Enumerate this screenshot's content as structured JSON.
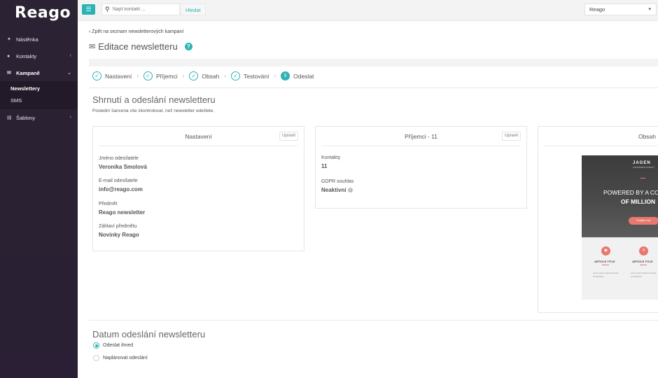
{
  "app": {
    "logo": "Reago"
  },
  "sidebar": {
    "items": [
      {
        "label": "Nástěnka",
        "icon": "pin-icon"
      },
      {
        "label": "Kontakty",
        "icon": "users-icon"
      },
      {
        "label": "Kampaně",
        "icon": "envelope-icon"
      },
      {
        "label": "Šablony",
        "icon": "book-icon"
      }
    ],
    "campaign_sub": [
      {
        "label": "Newslettery"
      },
      {
        "label": "SMS"
      }
    ]
  },
  "topbar": {
    "search_placeholder": "Najít kontakt ...",
    "search_button": "Hledat",
    "account": "Reago"
  },
  "page": {
    "back_link": "Zpět na seznam newsletterových kampaní",
    "title": "Editace newsletteru",
    "steps": [
      "Nastavení",
      "Příjemci",
      "Obsah",
      "Testování",
      "Odeslat"
    ],
    "current_step_number": "5",
    "summary_title": "Shrnutí a odeslání newsletteru",
    "summary_subtitle": "Poslední šancena vše zkontrolovat, než newsletter odešlete."
  },
  "cards": {
    "settings": {
      "title": "Nastavení",
      "edit": "Upravit",
      "fields": [
        {
          "label": "Jméno odesílatele",
          "value": "Veronika Smolová"
        },
        {
          "label": "E-mail odesílatele",
          "value": "info@reago.com"
        },
        {
          "label": "Předmět",
          "value": "Reago newsletter"
        },
        {
          "label": "Záhlaví předmětu",
          "value": "Novinky Reago"
        }
      ]
    },
    "recipients": {
      "title": "Příjemci - 11",
      "edit": "Upravit",
      "fields": [
        {
          "label": "Kontakty",
          "value": "11"
        },
        {
          "label": "GDPR souhlas",
          "value": "Neaktivní"
        }
      ]
    },
    "content": {
      "title": "Obsah",
      "preview": {
        "brand": "JAGEN",
        "brand_sub": "A BUSINESS AGENCY",
        "headline1": "POWERED BY A CO",
        "headline2": "OF MILLION",
        "cta": "Register now",
        "article_title": "ARTICLE TITLE",
        "article_text": "Lorem ipsum dolor sit amet, consectetur"
      }
    }
  },
  "send_date": {
    "title": "Datum odeslání newsletteru",
    "options": [
      {
        "label": "Odeslat ihned",
        "selected": true
      },
      {
        "label": "Naplánovat odeslání",
        "selected": false
      }
    ]
  },
  "colors": {
    "accent": "#2bb3b3",
    "sidebar": "#2b2233",
    "preview_accent": "#e9786f"
  }
}
